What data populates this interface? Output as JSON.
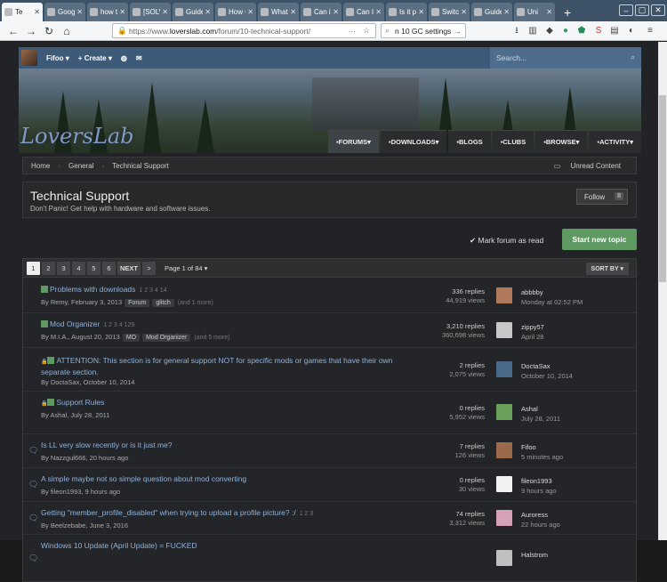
{
  "browser": {
    "tabs": [
      {
        "label": "Te",
        "active": true
      },
      {
        "label": "Goog",
        "active": false
      },
      {
        "label": "how t",
        "active": false
      },
      {
        "label": "[SOLV",
        "active": false
      },
      {
        "label": "Guide",
        "active": false
      },
      {
        "label": "How C",
        "active": false
      },
      {
        "label": "What",
        "active": false
      },
      {
        "label": "Can i",
        "active": false
      },
      {
        "label": "Can I",
        "active": false
      },
      {
        "label": "Is it p",
        "active": false
      },
      {
        "label": "Switc",
        "active": false
      },
      {
        "label": "Guide",
        "active": false
      },
      {
        "label": "Uni",
        "active": false
      }
    ],
    "url_prefix": "https://www.",
    "url_domain": "loverslab.com",
    "url_path": "/forum/10-technical-support/",
    "search_text": "n 10 GC settings"
  },
  "userbar": {
    "username": "Fifoo",
    "create_label": "Create",
    "search_placeholder": "Search..."
  },
  "logo": "LoversLab",
  "mainnav": [
    "FORUMS",
    "DOWNLOADS",
    "BLOGS",
    "CLUBS",
    "BROWSE",
    "ACTIVITY"
  ],
  "breadcrumbs": [
    "Home",
    "General",
    "Technical Support"
  ],
  "unread_label": "Unread Content",
  "forum": {
    "title": "Technical Support",
    "description": "Don't Panic! Get help with hardware and software issues.",
    "follow_label": "Follow",
    "follow_count": "8",
    "mark_read": "Mark forum as read",
    "new_topic": "Start new topic"
  },
  "pager": {
    "pages": [
      "1",
      "2",
      "3",
      "4",
      "5",
      "6"
    ],
    "next": "NEXT",
    "last": ">",
    "page_of": "Page 1 of 84",
    "sort": "SORT BY"
  },
  "topics": [
    {
      "title": "Problems with downloads",
      "pinned": true,
      "locked": false,
      "meta": "By Remy, February 3, 2013",
      "pages": "1 2 3 4 14",
      "tags": [
        "Forum",
        "glitch"
      ],
      "more": "(and 1 more)",
      "replies": "336 replies",
      "views": "44,919 views",
      "user": "abbbby",
      "time": "Monday at 02:52 PM",
      "av": "#b07a5a"
    },
    {
      "title": "Mod Organizer",
      "pinned": true,
      "locked": false,
      "meta": "By M.I.A., August 20, 2013",
      "pages": "1 2 3 4 129",
      "tags": [
        "MO",
        "Mod Organizer"
      ],
      "more": "(and 5 more)",
      "replies": "3,210 replies",
      "views": "360,698 views",
      "user": "zippy57",
      "time": "April 28",
      "av": "#c8c8c8"
    },
    {
      "title": "ATTENTION: This section is for general support NOT for specific mods or games that have their own separate section.",
      "pinned": true,
      "locked": true,
      "meta": "By DoctaSax, October 10, 2014",
      "pages": "",
      "tags": [],
      "more": "",
      "replies": "2 replies",
      "views": "2,075 views",
      "user": "DoctaSax",
      "time": "October 10, 2014",
      "av": "#4a6a8a"
    },
    {
      "title": "Support Rules",
      "pinned": true,
      "locked": true,
      "meta": "By Ashal, July 28, 2011",
      "pages": "",
      "tags": [],
      "more": "",
      "replies": "0 replies",
      "views": "5,952 views",
      "user": "Ashal",
      "time": "July 28, 2011",
      "av": "#6aa05a"
    },
    {
      "title": "Is LL very slow recently or is it just me?",
      "pinned": false,
      "locked": false,
      "meta": "By Nazzgul666, 20 hours ago",
      "pages": "",
      "tags": [],
      "more": "",
      "replies": "7 replies",
      "views": "126 views",
      "user": "Fifoo",
      "time": "5 minutes ago",
      "av": "#9a6a4a"
    },
    {
      "title": "A simple maybe not so simple question about mod converting",
      "pinned": false,
      "locked": false,
      "meta": "By fileon1993, 9 hours ago",
      "pages": "",
      "tags": [],
      "more": "",
      "replies": "0 replies",
      "views": "30 views",
      "user": "fileon1993",
      "time": "9 hours ago",
      "av": "#f2f2f2"
    },
    {
      "title": "Getting \"member_profile_disabled\" when trying to upload a profile picture? :/",
      "pinned": false,
      "locked": false,
      "meta": "By Beelzebabe, June 3, 2016",
      "pages": "1 2 3",
      "tags": [],
      "more": "",
      "replies": "74 replies",
      "views": "3,312 views",
      "user": "Auroress",
      "time": "22 hours ago",
      "av": "#d6a0b8"
    },
    {
      "title": "Windows 10 Update (April Update) = FUCKED",
      "pinned": false,
      "locked": false,
      "meta": "",
      "pages": "",
      "tags": [],
      "more": "",
      "replies": "",
      "views": "",
      "user": "Halstrom",
      "time": "",
      "av": "#c0c0c0"
    }
  ]
}
